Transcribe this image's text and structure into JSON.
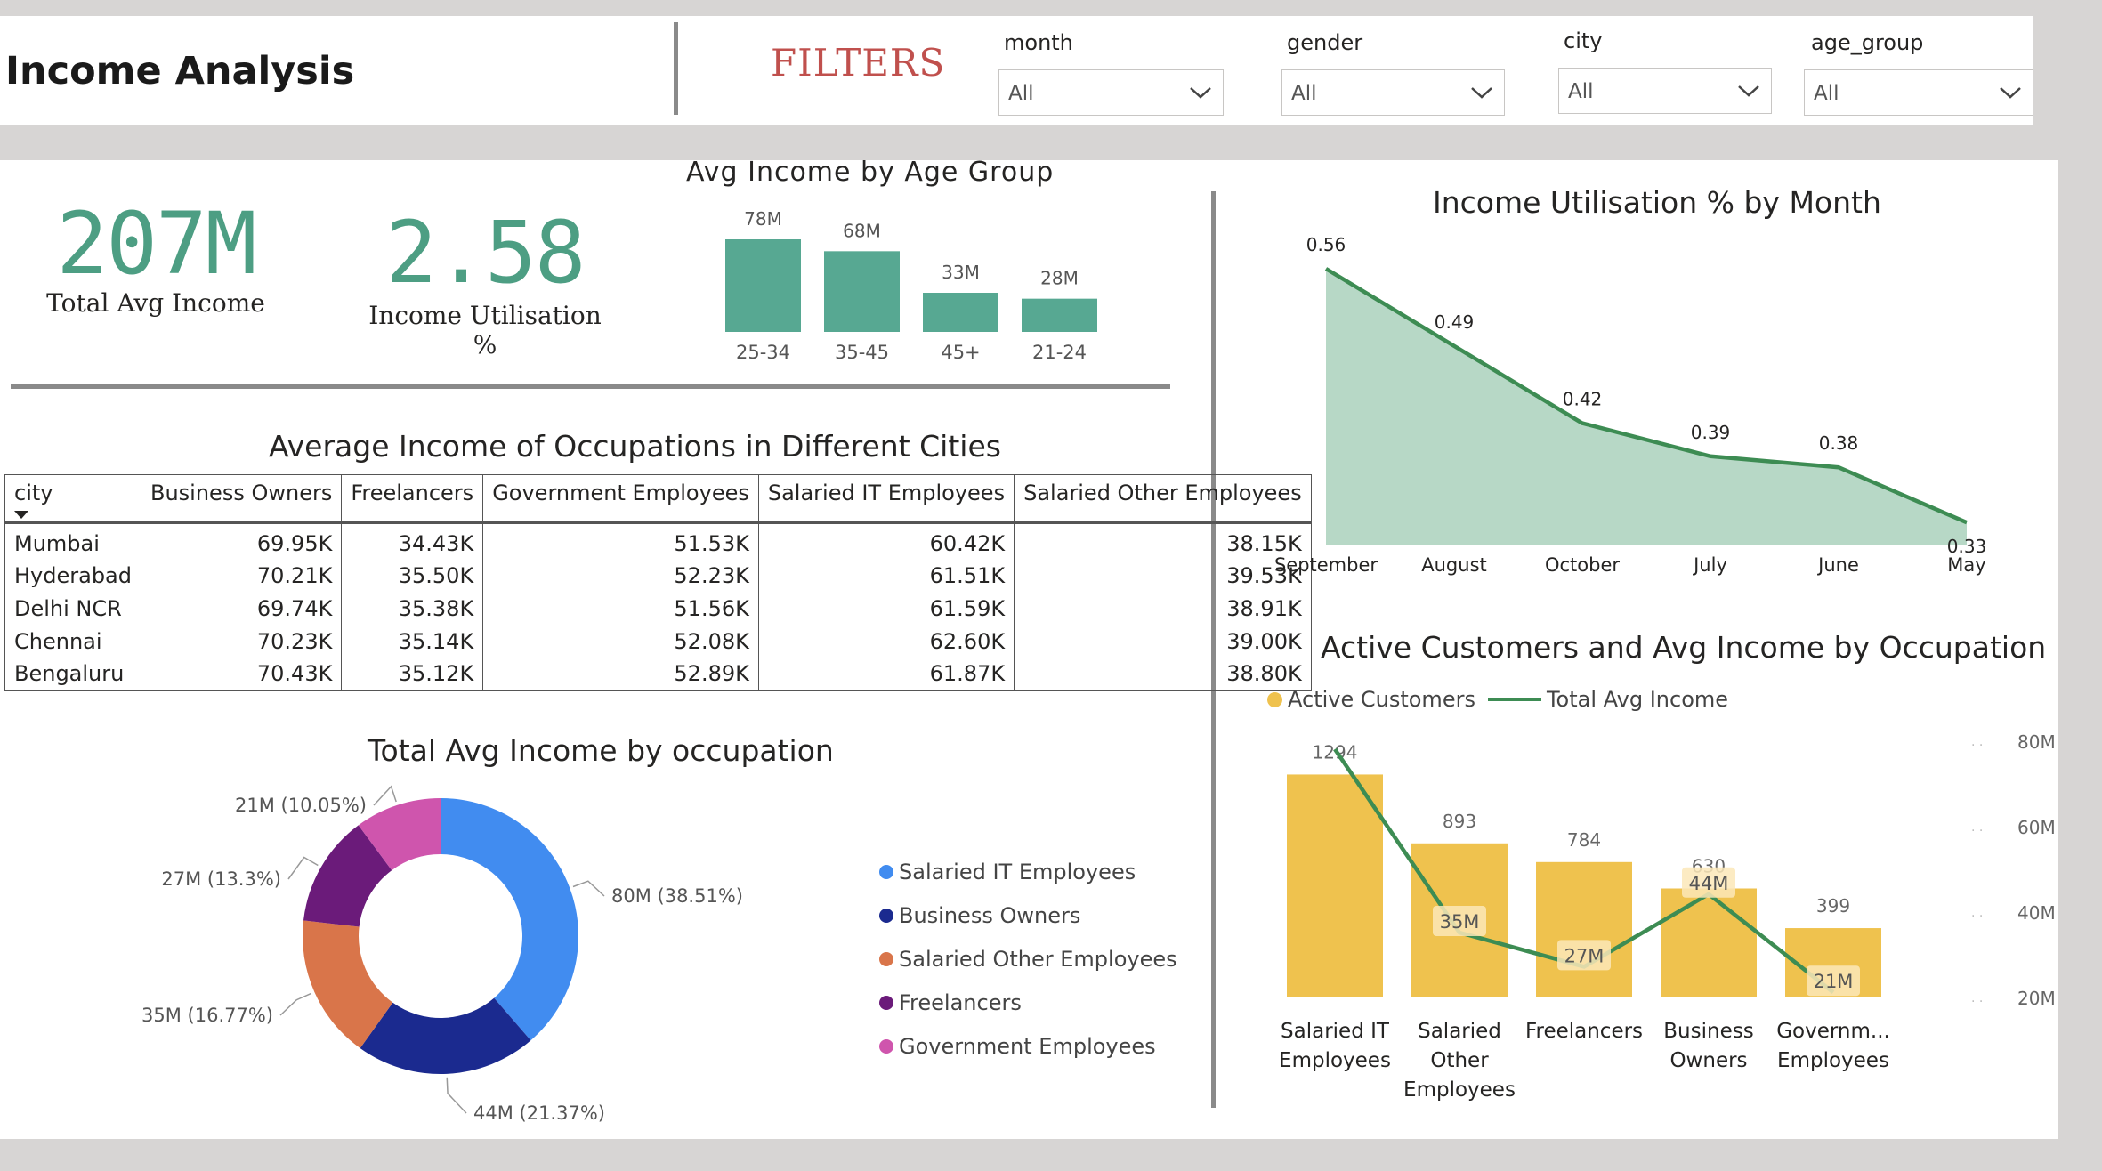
{
  "header": {
    "title": "Income Analysis",
    "filters_label": "FILTERS",
    "slicers": [
      {
        "label": "month",
        "value": "All"
      },
      {
        "label": "gender",
        "value": "All"
      },
      {
        "label": "city",
        "value": "All"
      },
      {
        "label": "age_group",
        "value": "All"
      }
    ]
  },
  "kpis": {
    "total_avg_income": {
      "value": "207M",
      "label": "Total Avg Income"
    },
    "income_utilisation": {
      "value": "2.58",
      "label": "Income Utilisation %"
    }
  },
  "colors": {
    "teal": "#57a892",
    "area_fill": "#b7d8c6",
    "area_line": "#3d8c53",
    "bar_yellow": "#efc24e",
    "line_green": "#3d8c53",
    "filters_red": "#c0504d"
  },
  "icons": {
    "dropdown": "chevron-down-icon",
    "sort": "sort-down-icon"
  },
  "age_chart": {
    "title": "Avg Income by Age Group",
    "chart_data": {
      "type": "bar",
      "categories": [
        "25-34",
        "35-45",
        "45+",
        "21-24"
      ],
      "values": [
        78,
        68,
        33,
        28
      ],
      "labels": [
        "78M",
        "68M",
        "33M",
        "28M"
      ],
      "unit": "M"
    }
  },
  "matrix": {
    "title": "Average Income of Occupations in Different Cities",
    "columns": [
      "city",
      "Business Owners",
      "Freelancers",
      "Government Employees",
      "Salaried IT Employees",
      "Salaried Other Employees"
    ],
    "rows": [
      [
        "Mumbai",
        "69.95K",
        "34.43K",
        "51.53K",
        "60.42K",
        "38.15K"
      ],
      [
        "Hyderabad",
        "70.21K",
        "35.50K",
        "52.23K",
        "61.51K",
        "39.53K"
      ],
      [
        "Delhi NCR",
        "69.74K",
        "35.38K",
        "51.56K",
        "61.59K",
        "38.91K"
      ],
      [
        "Chennai",
        "70.23K",
        "35.14K",
        "52.08K",
        "62.60K",
        "39.00K"
      ],
      [
        "Bengaluru",
        "70.43K",
        "35.12K",
        "52.89K",
        "61.87K",
        "38.80K"
      ]
    ]
  },
  "donut": {
    "title": "Total Avg Income by occupation",
    "chart_data": {
      "type": "pie",
      "slices": [
        {
          "name": "Salaried IT Employees",
          "value": 80,
          "label": "80M (38.51%)",
          "color": "#418cf0"
        },
        {
          "name": "Business Owners",
          "value": 44,
          "label": "44M (21.37%)",
          "color": "#1b2a8f"
        },
        {
          "name": "Salaried Other Employees",
          "value": 35,
          "label": "35M (16.77%)",
          "color": "#d9754a"
        },
        {
          "name": "Freelancers",
          "value": 27,
          "label": "27M (13.3%)",
          "color": "#6b1b7a"
        },
        {
          "name": "Government Employees",
          "value": 21,
          "label": "21M (10.05%)",
          "color": "#cf55ad"
        }
      ]
    }
  },
  "area_chart": {
    "title": "Income Utilisation % by Month",
    "chart_data": {
      "type": "area",
      "categories": [
        "September",
        "August",
        "October",
        "July",
        "June",
        "May"
      ],
      "values": [
        0.56,
        0.49,
        0.42,
        0.39,
        0.38,
        0.33
      ],
      "labels": [
        "0.56",
        "0.49",
        "0.42",
        "0.39",
        "0.38",
        "0.33"
      ]
    }
  },
  "combo_chart": {
    "title": "Active Customers and Avg Income by Occupation",
    "legend": [
      "Active Customers",
      "Total Avg Income"
    ],
    "chart_data": {
      "type": "bar",
      "categories": [
        "Salaried IT Employees",
        "Salaried Other Employees",
        "Freelancers",
        "Business Owners",
        "Governm... Employees"
      ],
      "category_lines": [
        [
          "Salaried IT",
          "Employees"
        ],
        [
          "Salaried",
          "Other",
          "Employees"
        ],
        [
          "Freelancers"
        ],
        [
          "Business",
          "Owners"
        ],
        [
          "Governm...",
          "Employees"
        ]
      ],
      "series": [
        {
          "name": "Active Customers",
          "type": "bar",
          "values": [
            1294,
            893,
            784,
            630,
            399
          ],
          "labels": [
            "1294",
            "893",
            "784",
            "630",
            "399"
          ]
        },
        {
          "name": "Total Avg Income",
          "type": "line",
          "values": [
            80,
            35,
            27,
            44,
            21
          ],
          "labels": [
            "",
            "35M",
            "27M",
            "44M",
            "21M"
          ]
        }
      ],
      "y2_ticks": [
        "80M",
        "60M",
        "40M",
        "20M"
      ],
      "y2_values": [
        80,
        60,
        40,
        20
      ]
    }
  }
}
